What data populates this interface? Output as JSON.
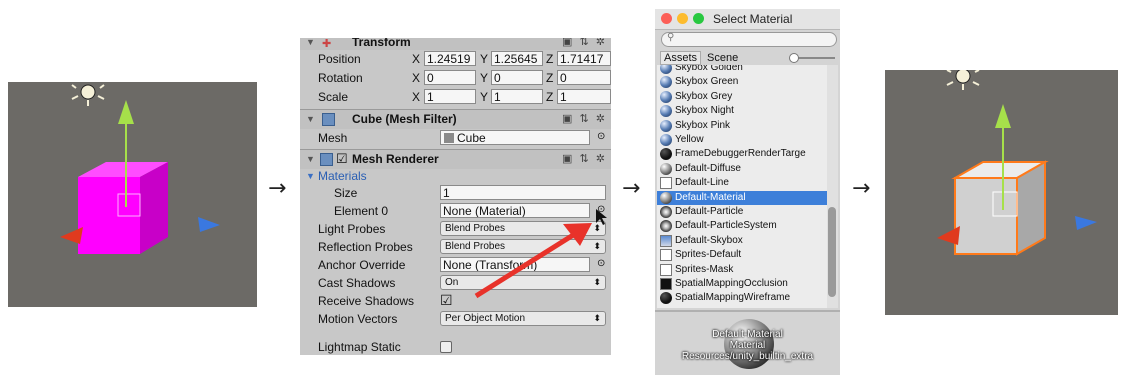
{
  "arrows": [
    "→",
    "→",
    "→"
  ],
  "inspector": {
    "transform": {
      "title": "Transform",
      "rows": [
        {
          "label": "Position",
          "x": "1.24519",
          "y": "1.25645",
          "z": "1.71417"
        },
        {
          "label": "Rotation",
          "x": "0",
          "y": "0",
          "z": "0"
        },
        {
          "label": "Scale",
          "x": "1",
          "y": "1",
          "z": "1"
        }
      ],
      "axis_x": "X",
      "axis_y": "Y",
      "axis_z": "Z"
    },
    "mesh_filter": {
      "title": "Cube (Mesh Filter)",
      "mesh_label": "Mesh",
      "mesh_value": "Cube"
    },
    "mesh_renderer": {
      "title": "Mesh Renderer",
      "materials_label": "Materials",
      "size_label": "Size",
      "size_value": "1",
      "element0_label": "Element 0",
      "element0_value": "None (Material)",
      "light_probes_label": "Light Probes",
      "light_probes_value": "Blend Probes",
      "reflection_probes_label": "Reflection Probes",
      "reflection_probes_value": "Blend Probes",
      "anchor_override_label": "Anchor Override",
      "anchor_override_value": "None (Transform)",
      "cast_shadows_label": "Cast Shadows",
      "cast_shadows_value": "On",
      "receive_shadows_label": "Receive Shadows",
      "motion_vectors_label": "Motion Vectors",
      "motion_vectors_value": "Per Object Motion",
      "lightmap_static_label": "Lightmap Static"
    }
  },
  "select_material": {
    "title": "Select Material",
    "search_placeholder": "",
    "tabs": [
      "Assets",
      "Scene"
    ],
    "items": [
      {
        "label": "Skybox Golden",
        "icon": "sphere-blue"
      },
      {
        "label": "Skybox Green",
        "icon": "sphere-blue"
      },
      {
        "label": "Skybox Grey",
        "icon": "sphere-blue"
      },
      {
        "label": "Skybox Night",
        "icon": "sphere-blue"
      },
      {
        "label": "Skybox Pink",
        "icon": "sphere-blue"
      },
      {
        "label": "Yellow",
        "icon": "sphere-blue"
      },
      {
        "label": "FrameDebuggerRenderTarge",
        "icon": "sphere-black"
      },
      {
        "label": "Default-Diffuse",
        "icon": "sphere-grey"
      },
      {
        "label": "Default-Line",
        "icon": "square-white"
      },
      {
        "label": "Default-Material",
        "icon": "sphere-grey",
        "selected": true
      },
      {
        "label": "Default-Particle",
        "icon": "particle"
      },
      {
        "label": "Default-ParticleSystem",
        "icon": "particle"
      },
      {
        "label": "Default-Skybox",
        "icon": "gradient"
      },
      {
        "label": "Sprites-Default",
        "icon": "square-white"
      },
      {
        "label": "Sprites-Mask",
        "icon": "square-white"
      },
      {
        "label": "SpatialMappingOcclusion",
        "icon": "square-black"
      },
      {
        "label": "SpatialMappingWireframe",
        "icon": "sphere-black"
      }
    ],
    "preview": {
      "name": "Default-Material",
      "type": "Material",
      "path": "Resources/unity_builtin_extra"
    }
  },
  "colors": {
    "selection": "#3d7fd9",
    "highlight_arrow": "#e8322a",
    "magenta_cube": "#ff00ff",
    "inspector_bg": "#c8c8c8"
  }
}
